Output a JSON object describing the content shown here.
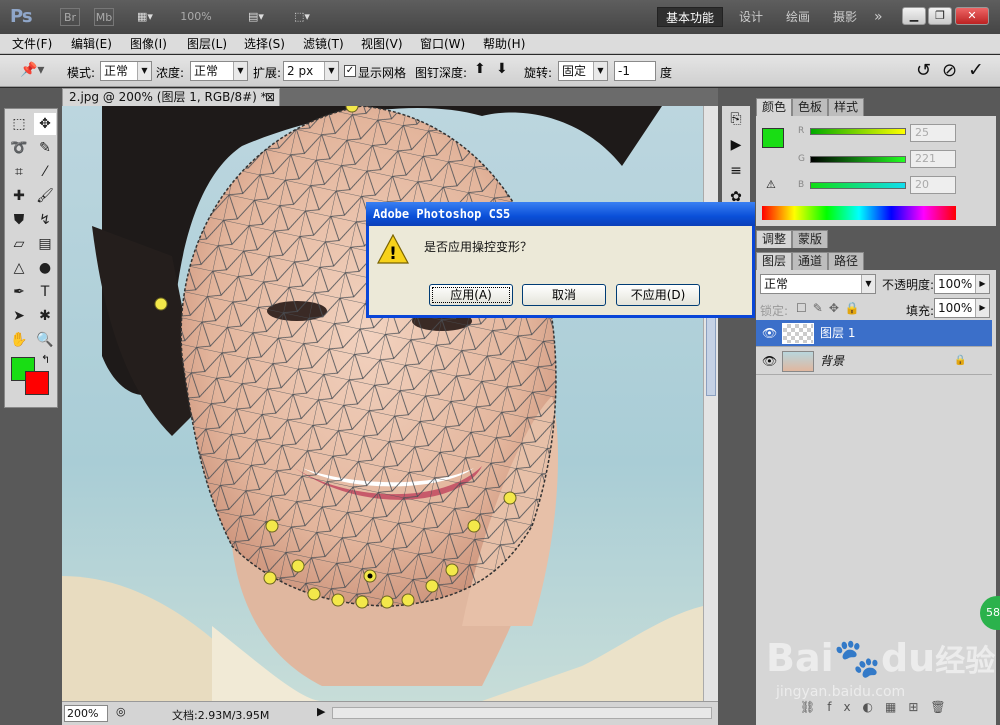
{
  "app": {
    "logo": "Ps",
    "icons": [
      "Br",
      "Mb"
    ],
    "zoom": "100%",
    "workspaces": [
      "基本功能",
      "设计",
      "绘画",
      "摄影"
    ],
    "more": "»"
  },
  "menu": [
    "文件(F)",
    "编辑(E)",
    "图像(I)",
    "图层(L)",
    "选择(S)",
    "滤镜(T)",
    "视图(V)",
    "窗口(W)",
    "帮助(H)"
  ],
  "options": {
    "mode_label": "模式:",
    "mode_value": "正常",
    "density_label": "浓度:",
    "density_value": "正常",
    "expand_label": "扩展:",
    "expand_value": "2 px",
    "show_mesh_label": "显示网格",
    "show_mesh_checked": true,
    "pin_depth_label": "图钉深度:",
    "rotate_label": "旋转:",
    "rotate_value": "固定",
    "angle_value": "-1",
    "angle_unit": "度"
  },
  "document": {
    "tab_title": "2.jpg @ 200% (图层 1, RGB/8#) *",
    "zoom": "200%",
    "doc_info": "文档:2.93M/3.95M"
  },
  "color_panel": {
    "tabs": [
      "颜色",
      "色板",
      "样式"
    ],
    "channels": [
      {
        "name": "R",
        "value": "25"
      },
      {
        "name": "G",
        "value": "221"
      },
      {
        "name": "B",
        "value": "20"
      }
    ],
    "foreground": "#19dd14",
    "background": "#ff0000"
  },
  "adjust_tabs": [
    "调整",
    "蒙版"
  ],
  "layers_panel": {
    "tabs": [
      "图层",
      "通道",
      "路径"
    ],
    "blend_mode": "正常",
    "opacity_label": "不透明度:",
    "opacity_value": "100%",
    "lock_label": "锁定:",
    "fill_label": "填充:",
    "fill_value": "100%",
    "layers": [
      {
        "name": "图层 1",
        "selected": true
      },
      {
        "name": "背景",
        "selected": false,
        "locked": true
      }
    ]
  },
  "dialog": {
    "title": "Adobe Photoshop CS5",
    "message": "是否应用操控变形？",
    "buttons": [
      "应用(A)",
      "取消",
      "不应用(D)"
    ]
  },
  "watermark": {
    "brand": "Bai",
    "brand2": "du",
    "cn": "经验",
    "url": "jingyan.baidu.com",
    "badge": "58"
  }
}
